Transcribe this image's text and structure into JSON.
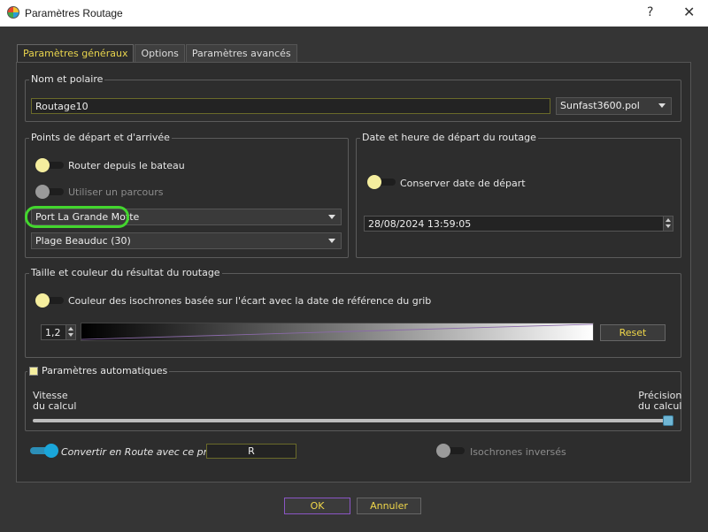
{
  "window": {
    "title": "Paramètres Routage",
    "help_label": "?",
    "close_label": "✕"
  },
  "tabs": [
    {
      "label": "Paramètres généraux",
      "active": true
    },
    {
      "label": "Options",
      "active": false
    },
    {
      "label": "Paramètres avancés",
      "active": false
    }
  ],
  "name_polar": {
    "title": "Nom et polaire",
    "name_value": "Routage10",
    "polar_value": "Sunfast3600.pol"
  },
  "departure_arrival": {
    "title": "Points de départ et d'arrivée",
    "from_boat_label": "Router depuis le bateau",
    "use_route_label": "Utiliser un parcours",
    "start_point": "Port La Grande Motte",
    "end_point": "Plage Beauduc (30)"
  },
  "departure_date": {
    "title": "Date et heure de départ du routage",
    "keep_date_label": "Conserver date de départ",
    "datetime_value": "28/08/2024 13:59:05"
  },
  "result_style": {
    "title": "Taille et couleur du résultat du routage",
    "isochrone_color_label": "Couleur des isochrones basée sur l'écart avec la date de référence du grib",
    "width_value": "1,2",
    "reset_label": "Reset"
  },
  "auto_params": {
    "title": "Paramètres automatiques",
    "speed_label_1": "Vitesse",
    "speed_label_2": "du calcul",
    "precision_label_1": "Précision",
    "precision_label_2": "du calcul",
    "slider_value": 1.0
  },
  "convert": {
    "label": "Convertir en Route avec ce préfixe",
    "prefix_value": "R",
    "reversed_label": "Isochrones inversés"
  },
  "footer": {
    "ok_label": "OK",
    "cancel_label": "Annuler"
  },
  "colors": {
    "accent_yellow": "#f0d74a",
    "toggle_knob_off": "#f5ee9e",
    "toggle_on": "#1aa6da",
    "highlight_green": "#43d62e",
    "ok_border": "#8a55c4"
  }
}
